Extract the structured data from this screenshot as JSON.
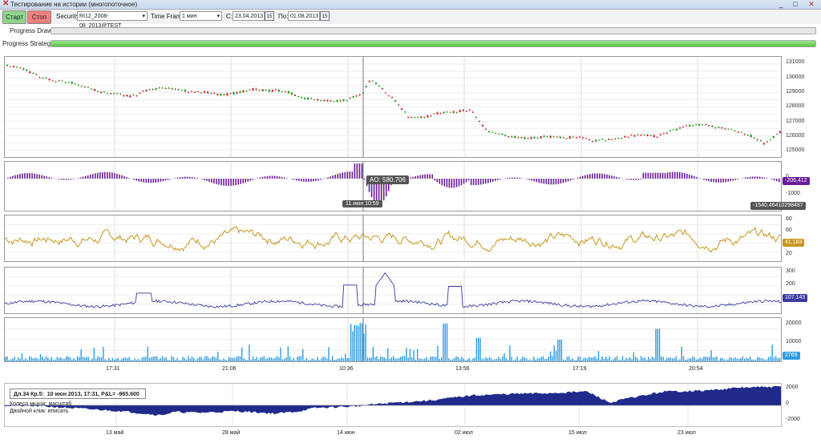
{
  "window": {
    "title": "Тестирование на истории (многопоточное)",
    "controls": [
      "_",
      "□",
      "✕"
    ]
  },
  "toolbar": {
    "start_label": "Старт",
    "stop_label": "Стоп",
    "security_label": "Security:",
    "security_value": "RI12_2008-08_2013@TEST",
    "timeframe_label": "Time Frame:",
    "timeframe_value": "1 мин",
    "from_label": "С:",
    "from_value": "23.04.2013",
    "to_label": "По:",
    "to_value": "01.08.2013",
    "calendar_glyph": "15"
  },
  "progress": {
    "draw_label": "Progress Draw:",
    "draw_value": 0,
    "strategy_label": "Progress Strategy:",
    "strategy_value": 1
  },
  "crosshair": {
    "ao_label": "AO: 580.706",
    "time_label": "11 июн 10:59"
  },
  "bottom_info": {
    "header": "Дл.34 Кр.5:",
    "detail": "10 июн 2013, 17:31, P&L= -965.600",
    "hint1": "Колесо мыши: масштаб",
    "hint2": "Двойной клик: вписать"
  },
  "colors": {
    "up": "#1a9a1a",
    "down": "#cc2222",
    "ao": "#6a1b9a",
    "rsi": "#c8961e",
    "cci": "#3a3aa0",
    "volume": "#2e9be0",
    "pnl": "#1f2a8a"
  },
  "chart_data": [
    {
      "type": "line",
      "name": "price",
      "ylim": [
        124700,
        131500
      ],
      "yticks": [
        125000,
        126000,
        127000,
        128000,
        129000,
        130000,
        131000
      ],
      "x": [
        0,
        2,
        4,
        6,
        8,
        10,
        12,
        14,
        16,
        18,
        20,
        22,
        24,
        26,
        28,
        30,
        32,
        34,
        36,
        38,
        40,
        42,
        44,
        46,
        47,
        48,
        50,
        52,
        54,
        56,
        58,
        60,
        62,
        64,
        66,
        68,
        70,
        72,
        74,
        76,
        78,
        80,
        82,
        84,
        86,
        88,
        90,
        92,
        94,
        96,
        98,
        100
      ],
      "values": [
        130900,
        130700,
        130200,
        129900,
        129800,
        129500,
        129100,
        129000,
        128800,
        129200,
        129400,
        129300,
        129100,
        129100,
        128900,
        129100,
        129300,
        129200,
        129200,
        128700,
        128600,
        128500,
        128600,
        129000,
        130000,
        129600,
        128600,
        127400,
        127400,
        127700,
        127800,
        127900,
        126500,
        126200,
        126000,
        126000,
        126100,
        126000,
        126100,
        125800,
        125900,
        126100,
        126200,
        126100,
        126500,
        126800,
        126900,
        126700,
        126500,
        126200,
        125600,
        126400
      ]
    },
    {
      "type": "bar",
      "name": "AO",
      "ylim": [
        -1900,
        1000
      ],
      "yticks": [
        0,
        -1000
      ],
      "last_label": "-206,412",
      "min_label": "-1540,46410298487",
      "seed": 3
    },
    {
      "type": "line",
      "name": "RSI",
      "ylim": [
        10,
        90
      ],
      "yticks": [
        80,
        60,
        40,
        20
      ],
      "last_label": "41,183",
      "seed": 7
    },
    {
      "type": "line",
      "name": "CCI",
      "ylim": [
        0,
        340
      ],
      "yticks": [
        300,
        200,
        100
      ],
      "last_label": "107,143",
      "seed": 11
    },
    {
      "type": "bar",
      "name": "Volume",
      "ylim": [
        0,
        24000
      ],
      "yticks": [
        20000,
        10000
      ],
      "last_label": "2769",
      "seed": 13
    },
    {
      "type": "area",
      "name": "P&L",
      "ylim": [
        -2600,
        2700
      ],
      "yticks": [
        2000,
        0,
        -2000
      ],
      "x": [
        0,
        5,
        10,
        15,
        20,
        22,
        25,
        30,
        35,
        38,
        40,
        45,
        50,
        55,
        60,
        65,
        70,
        75,
        78,
        80,
        85,
        90,
        95,
        100
      ],
      "values": [
        0,
        -100,
        -400,
        -700,
        -1200,
        -800,
        -900,
        -700,
        -1000,
        -700,
        -300,
        -100,
        300,
        600,
        1200,
        1400,
        1500,
        1700,
        300,
        800,
        1700,
        1800,
        2200,
        2300
      ]
    }
  ],
  "time_axis": [
    "17:31",
    "21:06",
    "10:36",
    "13:56",
    "17:19",
    "20:54"
  ],
  "date_axis": [
    "13 май",
    "28 май",
    "14 июн",
    "02 июл",
    "15 июл",
    "23 июл"
  ]
}
